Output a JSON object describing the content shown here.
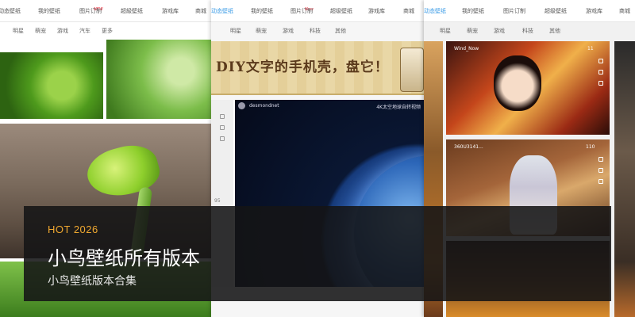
{
  "panels": [
    {
      "topnav": [
        "动态壁纸",
        "我的壁纸",
        "图片订制",
        "超級壁纸",
        "游戏库",
        "商城"
      ],
      "new_badge": "NEW",
      "subnav": [
        "明星",
        "萌宠",
        "游戏",
        "汽车",
        "更多"
      ]
    },
    {
      "topnav": [
        "动态壁纸",
        "我的壁纸",
        "图片订制",
        "超级壁纸",
        "游戏库",
        "商城"
      ],
      "new_badge": "New",
      "subnav": [
        "明星",
        "萌宠",
        "游戏",
        "科技",
        "其他"
      ],
      "banner_text": "DIY文字的手机壳，盘它！",
      "earth_author": "desmondnet",
      "earth_caption": "4K太空地球自转视频",
      "side_count": "95"
    },
    {
      "topnav": [
        "动态壁纸",
        "我的壁纸",
        "图片订制",
        "超级壁纸",
        "游戏库",
        "商城"
      ],
      "subnav": [
        "明星",
        "萌宠",
        "游戏",
        "科技",
        "其他"
      ],
      "card1_author": "Wind_Now",
      "card1_count": "11",
      "card2_author": "360U3141...",
      "card2_count": "110"
    }
  ],
  "overlay": {
    "tag": "HOT 2026",
    "title": "小鸟壁纸所有版本",
    "subtitle": "小鸟壁纸版本合集"
  },
  "colors": {
    "accent": "#3a9be6",
    "hot": "#f0a830",
    "overlay_bg": "#141416"
  }
}
